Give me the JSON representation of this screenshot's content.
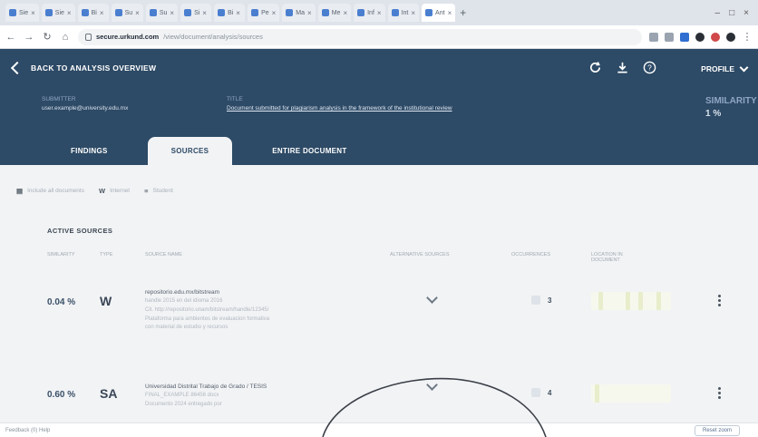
{
  "browser": {
    "tabs": [
      {
        "label": "Sie",
        "active": false
      },
      {
        "label": "Sie",
        "active": false
      },
      {
        "label": "Bi",
        "active": false
      },
      {
        "label": "Su",
        "active": false
      },
      {
        "label": "Su",
        "active": false
      },
      {
        "label": "Si",
        "active": false
      },
      {
        "label": "Bi",
        "active": false
      },
      {
        "label": "Pe",
        "active": false
      },
      {
        "label": "Ma",
        "active": false
      },
      {
        "label": "Me",
        "active": false
      },
      {
        "label": "Inf",
        "active": false
      },
      {
        "label": "Int",
        "active": false
      },
      {
        "label": "Ant",
        "active": true
      }
    ],
    "url_host": "secure.urkund.com",
    "url_path": "/view/document/analysis/sources"
  },
  "header": {
    "back_label": "BACK TO ANALYSIS OVERVIEW",
    "profile_label": "PROFILE",
    "submitter_label": "SUBMITTER",
    "submitter_value": "user.example@university.edu.mx",
    "title_label": "TITLE",
    "title_value": "Document submitted for plagiarism analysis in the framework of the institutional review",
    "similarity_label": "SIMILARITY",
    "similarity_value": "1 %"
  },
  "tabs": {
    "findings": "FINDINGS",
    "sources": "SOURCES",
    "entire_document": "ENTIRE DOCUMENT"
  },
  "filters": {
    "include": "Include all documents",
    "web": "Internet",
    "student": "Student"
  },
  "panel": {
    "title": "ACTIVE SOURCES",
    "col_similarity": "SIMILARITY",
    "col_type": "TYPE",
    "col_source": "SOURCE NAME",
    "col_alt": "ALTERNATIVE SOURCES",
    "col_occ": "OCCURRENCES",
    "col_dist": "LOCATION IN DOCUMENT"
  },
  "rows": [
    {
      "similarity": "0.04 %",
      "type": "W",
      "source_name": "repositorio.edu.mx/bitstream",
      "source_lines": [
        "handle 2015 en del idioma 2016",
        "Cit. http://repositorio.unam/bitstream/handle/12345/",
        "Plataforma para ambientes de evaluacion formativa",
        "con material de estudio y recursos"
      ],
      "occurrences": "3"
    },
    {
      "similarity": "0.60 %",
      "type": "SA",
      "source_name": "Universidad Distrital Trabajo de Grado / TESIS",
      "source_lines": [
        "FINAL_EXAMPLE 86456 docx",
        "Documento 2024 entregado por"
      ],
      "occurrences": "4"
    }
  ],
  "footer": {
    "left": "Feedback (0)  Help",
    "button": "Reset zoom"
  }
}
